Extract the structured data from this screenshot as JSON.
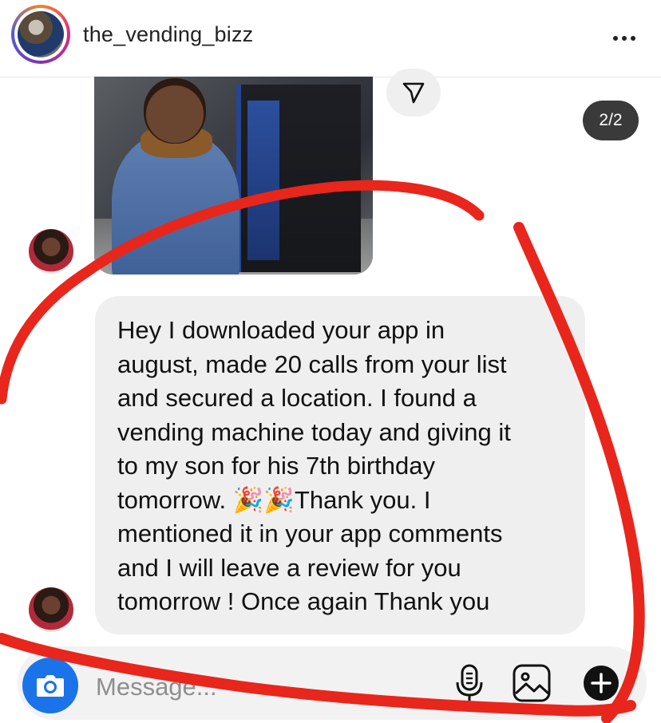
{
  "header": {
    "username": "the_vending_bizz"
  },
  "post": {
    "image_counter": "2/2"
  },
  "message": {
    "text": "Hey I downloaded your app in\naugust, made 20 calls from your list\nand secured a location. I found a\nvending machine today and giving it\nto my son for his 7th birthday\ntomorrow. 🎉🎉Thank you. I\nmentioned it in your app comments\nand I will leave a review for you\ntomorrow ! Once again Thank you"
  },
  "composer": {
    "placeholder": "Message..."
  },
  "colors": {
    "annotation": "#e8261c",
    "camera_button": "#1a73e8",
    "bubble": "#efefef",
    "counter_badge": "#3a3a3a"
  },
  "icons": [
    "more-icon",
    "share-icon",
    "camera-icon",
    "microphone-icon",
    "gallery-icon",
    "add-icon"
  ]
}
